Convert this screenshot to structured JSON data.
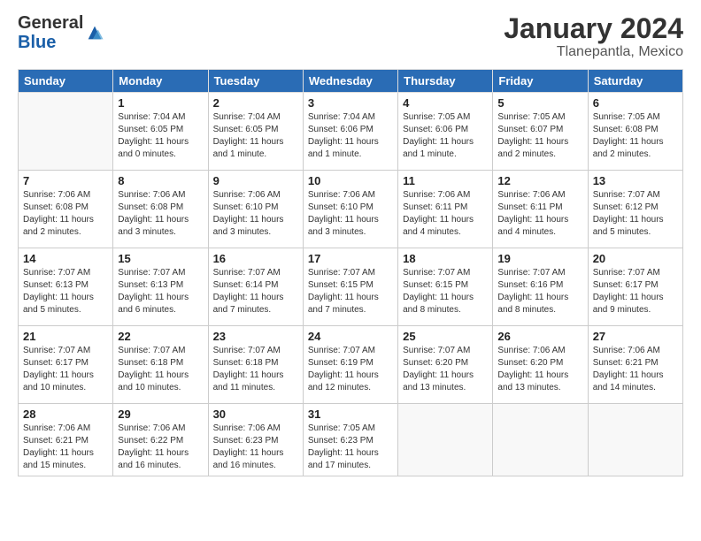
{
  "logo": {
    "general": "General",
    "blue": "Blue"
  },
  "header": {
    "month": "January 2024",
    "location": "Tlanepantla, Mexico"
  },
  "weekdays": [
    "Sunday",
    "Monday",
    "Tuesday",
    "Wednesday",
    "Thursday",
    "Friday",
    "Saturday"
  ],
  "weeks": [
    [
      {
        "day": "",
        "sunrise": "",
        "sunset": "",
        "daylight": ""
      },
      {
        "day": "1",
        "sunrise": "7:04 AM",
        "sunset": "6:05 PM",
        "daylight": "11 hours and 0 minutes."
      },
      {
        "day": "2",
        "sunrise": "7:04 AM",
        "sunset": "6:05 PM",
        "daylight": "11 hours and 1 minute."
      },
      {
        "day": "3",
        "sunrise": "7:04 AM",
        "sunset": "6:06 PM",
        "daylight": "11 hours and 1 minute."
      },
      {
        "day": "4",
        "sunrise": "7:05 AM",
        "sunset": "6:06 PM",
        "daylight": "11 hours and 1 minute."
      },
      {
        "day": "5",
        "sunrise": "7:05 AM",
        "sunset": "6:07 PM",
        "daylight": "11 hours and 2 minutes."
      },
      {
        "day": "6",
        "sunrise": "7:05 AM",
        "sunset": "6:08 PM",
        "daylight": "11 hours and 2 minutes."
      }
    ],
    [
      {
        "day": "7",
        "sunrise": "7:06 AM",
        "sunset": "6:08 PM",
        "daylight": "11 hours and 2 minutes."
      },
      {
        "day": "8",
        "sunrise": "7:06 AM",
        "sunset": "6:08 PM",
        "daylight": "11 hours and 3 minutes."
      },
      {
        "day": "9",
        "sunrise": "7:06 AM",
        "sunset": "6:10 PM",
        "daylight": "11 hours and 3 minutes."
      },
      {
        "day": "10",
        "sunrise": "7:06 AM",
        "sunset": "6:10 PM",
        "daylight": "11 hours and 3 minutes."
      },
      {
        "day": "11",
        "sunrise": "7:06 AM",
        "sunset": "6:11 PM",
        "daylight": "11 hours and 4 minutes."
      },
      {
        "day": "12",
        "sunrise": "7:06 AM",
        "sunset": "6:11 PM",
        "daylight": "11 hours and 4 minutes."
      },
      {
        "day": "13",
        "sunrise": "7:07 AM",
        "sunset": "6:12 PM",
        "daylight": "11 hours and 5 minutes."
      }
    ],
    [
      {
        "day": "14",
        "sunrise": "7:07 AM",
        "sunset": "6:13 PM",
        "daylight": "11 hours and 5 minutes."
      },
      {
        "day": "15",
        "sunrise": "7:07 AM",
        "sunset": "6:13 PM",
        "daylight": "11 hours and 6 minutes."
      },
      {
        "day": "16",
        "sunrise": "7:07 AM",
        "sunset": "6:14 PM",
        "daylight": "11 hours and 7 minutes."
      },
      {
        "day": "17",
        "sunrise": "7:07 AM",
        "sunset": "6:15 PM",
        "daylight": "11 hours and 7 minutes."
      },
      {
        "day": "18",
        "sunrise": "7:07 AM",
        "sunset": "6:15 PM",
        "daylight": "11 hours and 8 minutes."
      },
      {
        "day": "19",
        "sunrise": "7:07 AM",
        "sunset": "6:16 PM",
        "daylight": "11 hours and 8 minutes."
      },
      {
        "day": "20",
        "sunrise": "7:07 AM",
        "sunset": "6:17 PM",
        "daylight": "11 hours and 9 minutes."
      }
    ],
    [
      {
        "day": "21",
        "sunrise": "7:07 AM",
        "sunset": "6:17 PM",
        "daylight": "11 hours and 10 minutes."
      },
      {
        "day": "22",
        "sunrise": "7:07 AM",
        "sunset": "6:18 PM",
        "daylight": "11 hours and 10 minutes."
      },
      {
        "day": "23",
        "sunrise": "7:07 AM",
        "sunset": "6:18 PM",
        "daylight": "11 hours and 11 minutes."
      },
      {
        "day": "24",
        "sunrise": "7:07 AM",
        "sunset": "6:19 PM",
        "daylight": "11 hours and 12 minutes."
      },
      {
        "day": "25",
        "sunrise": "7:07 AM",
        "sunset": "6:20 PM",
        "daylight": "11 hours and 13 minutes."
      },
      {
        "day": "26",
        "sunrise": "7:06 AM",
        "sunset": "6:20 PM",
        "daylight": "11 hours and 13 minutes."
      },
      {
        "day": "27",
        "sunrise": "7:06 AM",
        "sunset": "6:21 PM",
        "daylight": "11 hours and 14 minutes."
      }
    ],
    [
      {
        "day": "28",
        "sunrise": "7:06 AM",
        "sunset": "6:21 PM",
        "daylight": "11 hours and 15 minutes."
      },
      {
        "day": "29",
        "sunrise": "7:06 AM",
        "sunset": "6:22 PM",
        "daylight": "11 hours and 16 minutes."
      },
      {
        "day": "30",
        "sunrise": "7:06 AM",
        "sunset": "6:23 PM",
        "daylight": "11 hours and 16 minutes."
      },
      {
        "day": "31",
        "sunrise": "7:05 AM",
        "sunset": "6:23 PM",
        "daylight": "11 hours and 17 minutes."
      },
      {
        "day": "",
        "sunrise": "",
        "sunset": "",
        "daylight": ""
      },
      {
        "day": "",
        "sunrise": "",
        "sunset": "",
        "daylight": ""
      },
      {
        "day": "",
        "sunrise": "",
        "sunset": "",
        "daylight": ""
      }
    ]
  ],
  "labels": {
    "sunrise": "Sunrise:",
    "sunset": "Sunset:",
    "daylight": "Daylight hours"
  }
}
